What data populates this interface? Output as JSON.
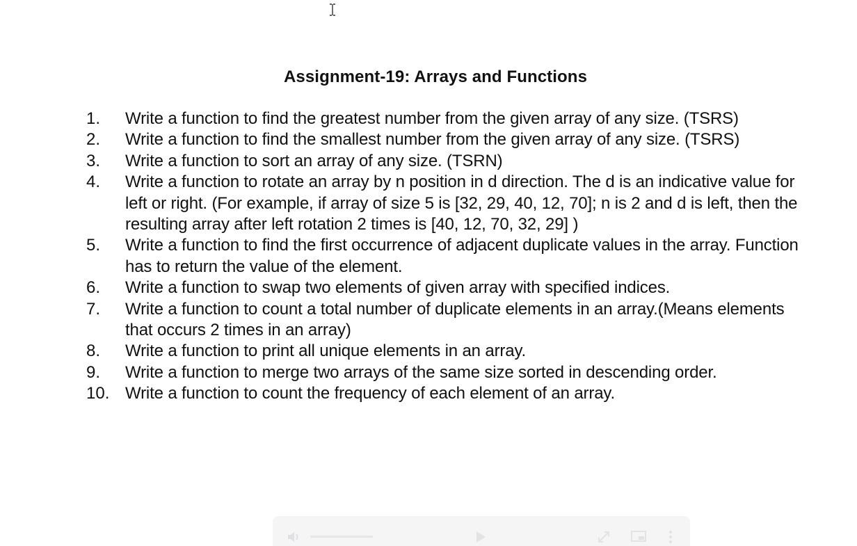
{
  "document": {
    "title": "Assignment-19: Arrays and Functions",
    "tasks": [
      {
        "number": "1.",
        "text": "Write a function to find the greatest number from the given array of any size. (TSRS)"
      },
      {
        "number": "2.",
        "text": "Write a function to find the smallest number from the given array of any size. (TSRS)"
      },
      {
        "number": "3.",
        "text": "Write a function to sort an array of any size. (TSRN)"
      },
      {
        "number": "4.",
        "text": "Write a function to rotate an array by n position in d direction. The d is an indicative value for left or right. (For example, if array of size 5 is [32, 29, 40, 12, 70];  n is 2 and d is left, then the resulting array after left rotation 2 times is [40, 12, 70, 32, 29] )"
      },
      {
        "number": "5.",
        "text": "Write a function to find the first occurrence of adjacent duplicate values in the array. Function has to return the value of the element."
      },
      {
        "number": "6.",
        "text": "Write a function to swap two elements of given array with specified indices."
      },
      {
        "number": "7.",
        "text": "Write a function to count a total number of duplicate elements in an array.(Means elements that occurs 2 times in an array)"
      },
      {
        "number": "8.",
        "text": "Write a function to print all unique elements in an array."
      },
      {
        "number": "9.",
        "text": "Write a function to merge two arrays of the same size sorted in descending order."
      },
      {
        "number": "10.",
        "text": "Write a function to count the frequency of each element of an array."
      }
    ]
  },
  "video_controls": {
    "icons": [
      "volume-icon",
      "play-icon",
      "fullscreen-icon",
      "picture-in-picture-icon",
      "more-options-icon"
    ]
  },
  "colors": {
    "text": "#111111",
    "link": "#1c2bd6",
    "controls_bg": "#f5f5f6"
  }
}
